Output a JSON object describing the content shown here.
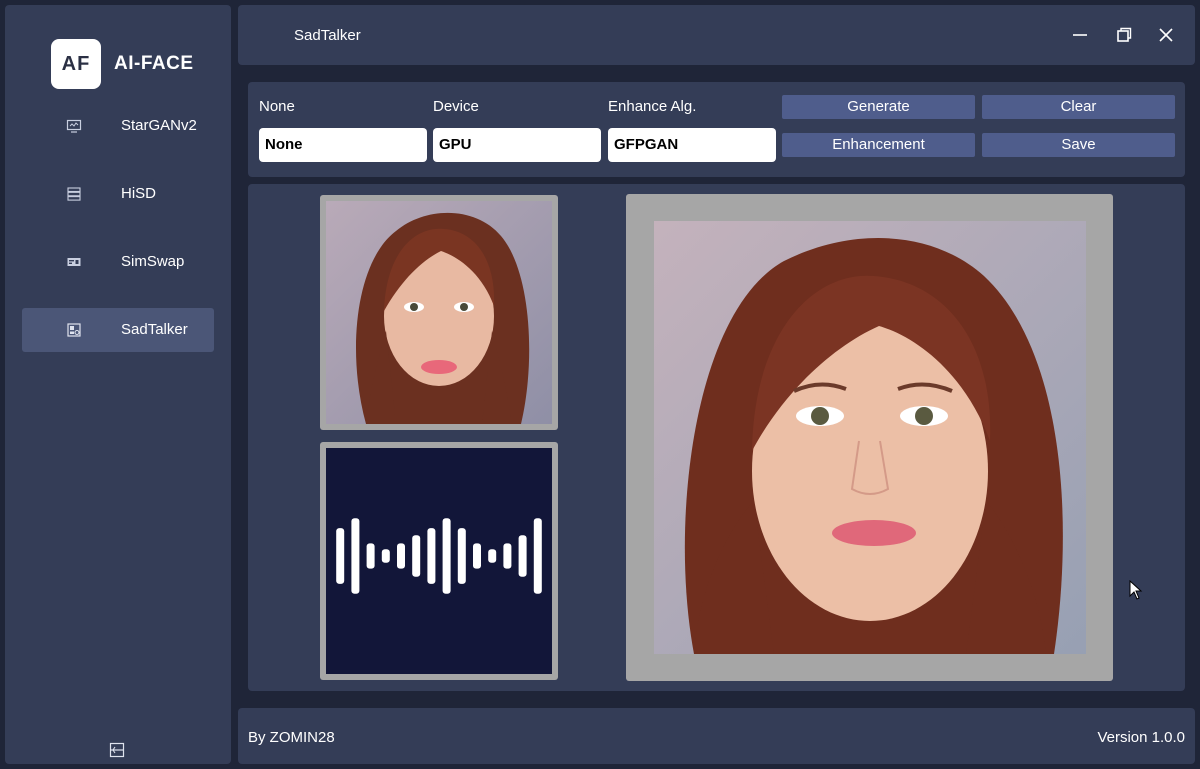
{
  "app": {
    "logo_initials": "AF",
    "logo_text": "AI-FACE",
    "window_title": "SadTalker"
  },
  "sidebar": {
    "items": [
      {
        "label": "StarGANv2",
        "icon": "monitor-icon",
        "active": false
      },
      {
        "label": "HiSD",
        "icon": "database-icon",
        "active": false
      },
      {
        "label": "SimSwap",
        "icon": "swap-card-icon",
        "active": false
      },
      {
        "label": "SadTalker",
        "icon": "portrait-card-icon",
        "active": true
      }
    ]
  },
  "controls": {
    "field1": {
      "label": "None",
      "value": "None"
    },
    "field2": {
      "label": "Device",
      "value": "GPU"
    },
    "field3": {
      "label": "Enhance Alg.",
      "value": "GFPGAN"
    },
    "buttons": {
      "generate": "Generate",
      "clear": "Clear",
      "enhancement": "Enhancement",
      "save": "Save"
    }
  },
  "audio": {
    "waveform_levels": [
      0.62,
      0.84,
      0.28,
      0.15,
      0.28,
      0.46,
      0.62,
      0.84,
      0.62,
      0.28,
      0.15,
      0.28,
      0.46,
      0.84
    ]
  },
  "footer": {
    "author": "By ZOMIN28",
    "version": "Version 1.0.0"
  },
  "colors": {
    "background": "#1f2538",
    "panel": "#343d57",
    "accent_button": "#4f5d8c",
    "active_nav": "#4b5677",
    "frame": "#a6a6a6",
    "audio_bg": "#121639"
  }
}
